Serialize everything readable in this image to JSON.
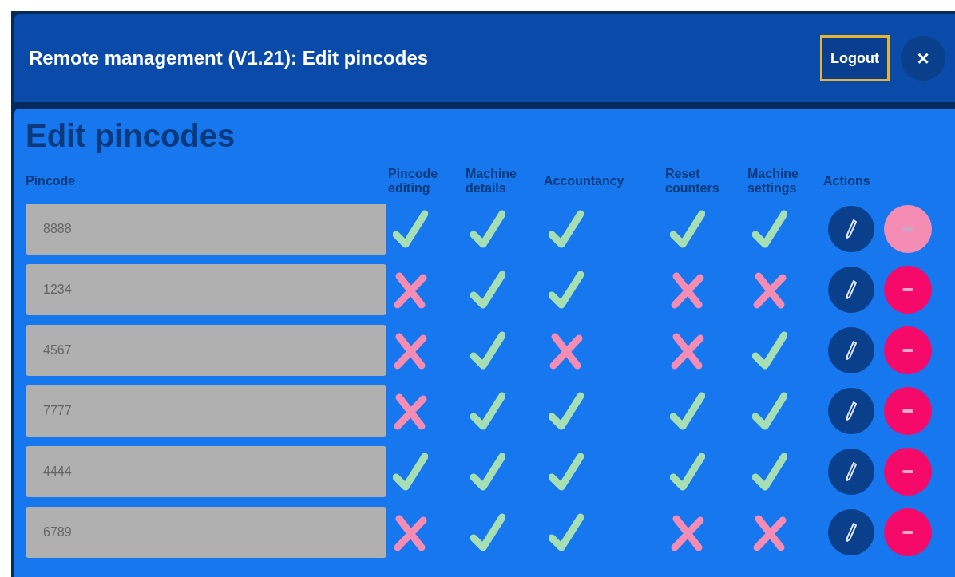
{
  "window": {
    "title": "Remote management (V1.21): Edit pincodes",
    "logout": "Logout",
    "close": "×"
  },
  "heading": "Edit pincodes",
  "columns": [
    "Pincode",
    "Pincode editing",
    "Machine details",
    "Accountancy",
    "Reset counters",
    "Machine settings",
    "Actions"
  ],
  "rows": [
    {
      "pincode": "8888",
      "permissions": [
        true,
        true,
        true,
        true,
        true
      ],
      "delete_disabled": true
    },
    {
      "pincode": "1234",
      "permissions": [
        false,
        true,
        true,
        false,
        false
      ],
      "delete_disabled": false
    },
    {
      "pincode": "4567",
      "permissions": [
        false,
        true,
        false,
        false,
        true
      ],
      "delete_disabled": false
    },
    {
      "pincode": "7777",
      "permissions": [
        false,
        true,
        true,
        true,
        true
      ],
      "delete_disabled": false
    },
    {
      "pincode": "4444",
      "permissions": [
        true,
        true,
        true,
        true,
        true
      ],
      "delete_disabled": false
    },
    {
      "pincode": "6789",
      "permissions": [
        false,
        true,
        true,
        false,
        false
      ],
      "delete_disabled": false
    }
  ]
}
